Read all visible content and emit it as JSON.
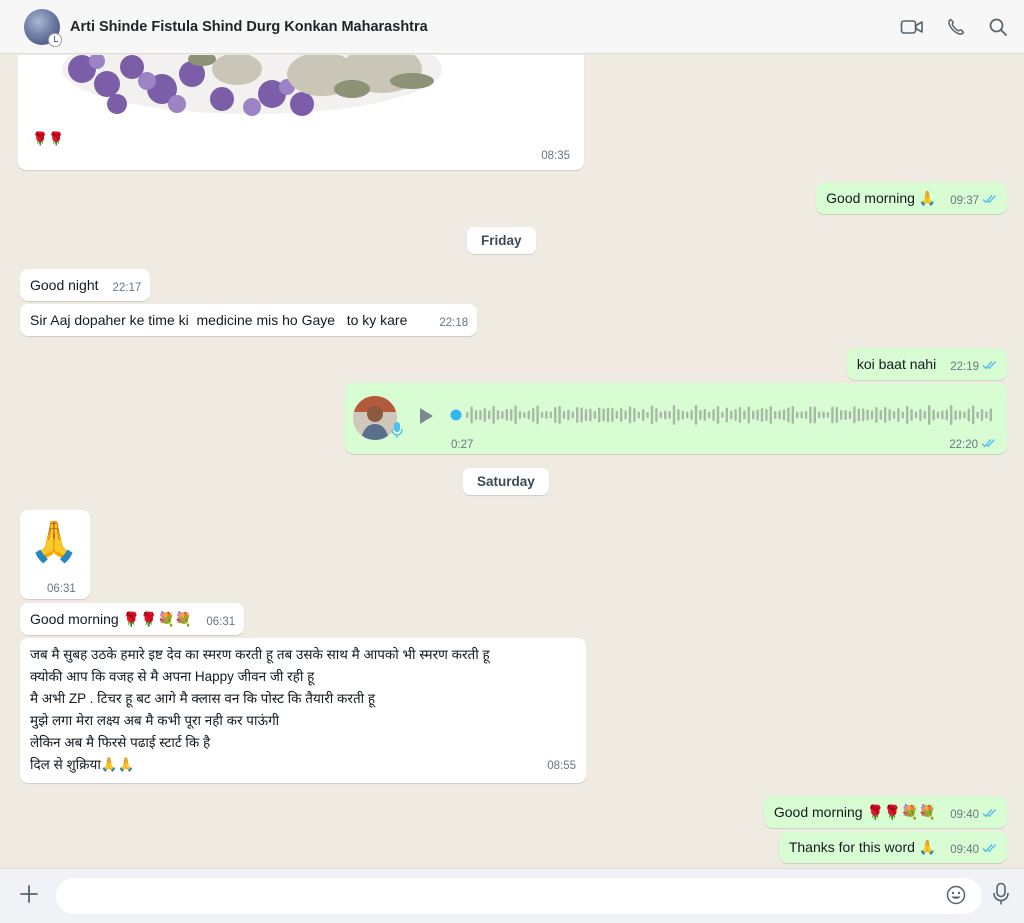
{
  "header": {
    "title": "Arti Shinde Fistula Shind Durg Konkan Maharashtra",
    "icons": [
      "video-call-icon",
      "voice-call-icon",
      "search-icon"
    ]
  },
  "messages": {
    "image_msg": {
      "caption": "🌹🌹",
      "time": "08:35"
    },
    "m1": {
      "text": "Good morning 🙏",
      "time": "09:37"
    },
    "date1": "Friday",
    "m2": {
      "text": "Good night",
      "time": "22:17"
    },
    "m3": {
      "text": "Sir Aaj dopaher ke time ki  medicine mis ho Gaye   to ky kare",
      "time": "22:18"
    },
    "m4": {
      "text": "koi baat nahi",
      "time": "22:19"
    },
    "voice": {
      "duration": "0:27",
      "time": "22:20"
    },
    "date2": "Saturday",
    "m5": {
      "emoji": "🙏",
      "time": "06:31"
    },
    "m6": {
      "text": "Good morning 🌹🌹💐💐",
      "time": "06:31"
    },
    "m7": {
      "lines": [
        "जब मै सुबह उठके हमारे इष्ट देव का स्मरण करती हू तब उसके साथ मै आपको भी स्मरण करती हू",
        "क्योकी आप कि वजह से मै अपना Happy जीवन जी रही हू",
        "मै अभी ZP . टिचर हू बट आगे मै क्लास वन कि पोस्ट कि तैयारी करती हू",
        "मुझे लगा मेरा लक्ष्य अब मै कभी पूरा नही कर पाऊंगी",
        "लेकिन अब मै फिरसे पढाई स्टार्ट कि है",
        "दिल से शुक्रिया🙏🙏"
      ],
      "time": "08:55"
    },
    "m8": {
      "text": "Good morning 🌹🌹💐💐",
      "time": "09:40"
    },
    "m9": {
      "text": "Thanks for this word 🙏",
      "time": "09:40"
    }
  },
  "composer": {
    "placeholder": ""
  },
  "colors": {
    "incoming": "#ffffff",
    "outgoing": "#d9fdd3",
    "chat_bg": "#efeae2",
    "read_ticks": "#53bdeb"
  }
}
